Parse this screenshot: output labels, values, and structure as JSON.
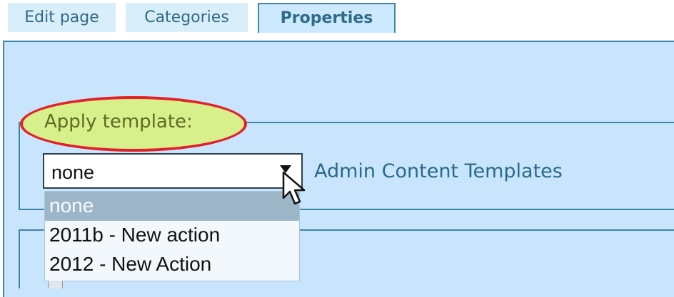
{
  "tabs": [
    {
      "label": "Edit page"
    },
    {
      "label": "Categories"
    },
    {
      "label": "Properties"
    }
  ],
  "fieldset": {
    "legend": "Apply template:"
  },
  "template_select": {
    "value": "none",
    "options": [
      {
        "label": "none"
      },
      {
        "label": "2011b - New action"
      },
      {
        "label": "2012 - New Action"
      }
    ]
  },
  "link": {
    "label": "Admin Content Templates"
  },
  "colors": {
    "panel_bg": "#c8e5fd",
    "tab_bg": "#d9eefb",
    "border": "#3d86a8",
    "highlight_outline": "#e3212a",
    "highlight_fill": "#d8f08c"
  },
  "icons": {
    "dropdown_arrow": "chevron-down-icon",
    "cursor": "mouse-cursor-icon"
  }
}
